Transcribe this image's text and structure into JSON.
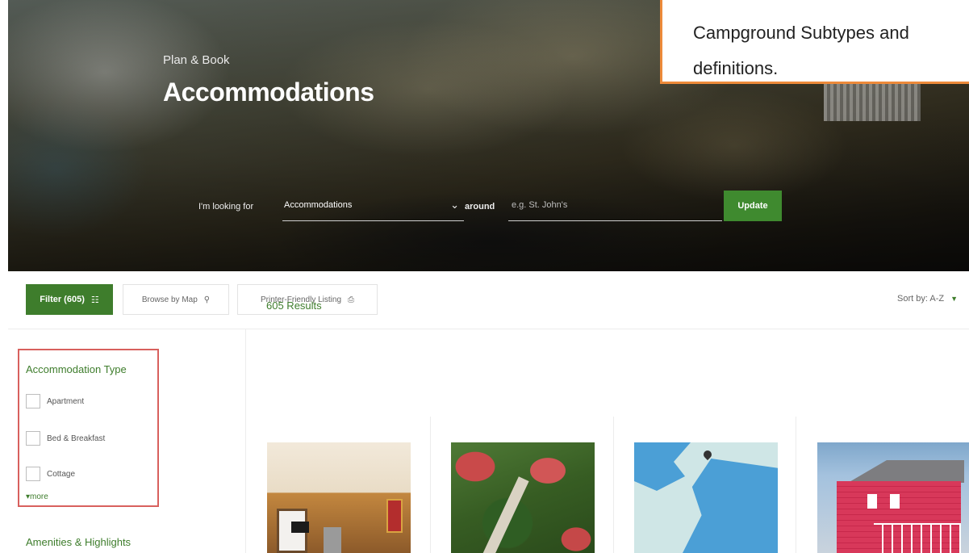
{
  "hero": {
    "eyebrow": "Plan & Book",
    "title": "Accommodations",
    "looking_for_label": "I'm looking for",
    "select_value": "Accommodations",
    "around_label": "around",
    "location_placeholder": "e.g. St. John's",
    "update_label": "Update"
  },
  "callout": {
    "line1": "Campground Subtypes and",
    "line2": "definitions."
  },
  "toolbar": {
    "filter_label": "Filter (605)",
    "browse_map_label": "Browse by Map",
    "printer_label": "Printer-Friendly Listing",
    "sort_label": "Sort by: A-Z"
  },
  "sidebar": {
    "type_title": "Accommodation Type",
    "types": [
      "Apartment",
      "Bed & Breakfast",
      "Cottage"
    ],
    "more_label": "more",
    "amenities_title": "Amenities & Highlights"
  },
  "results": {
    "count_label": "605 Results"
  },
  "colors": {
    "accent_green": "#3e7d2c",
    "callout_border": "#ed8a3a",
    "highlight_red": "#d8605d"
  }
}
